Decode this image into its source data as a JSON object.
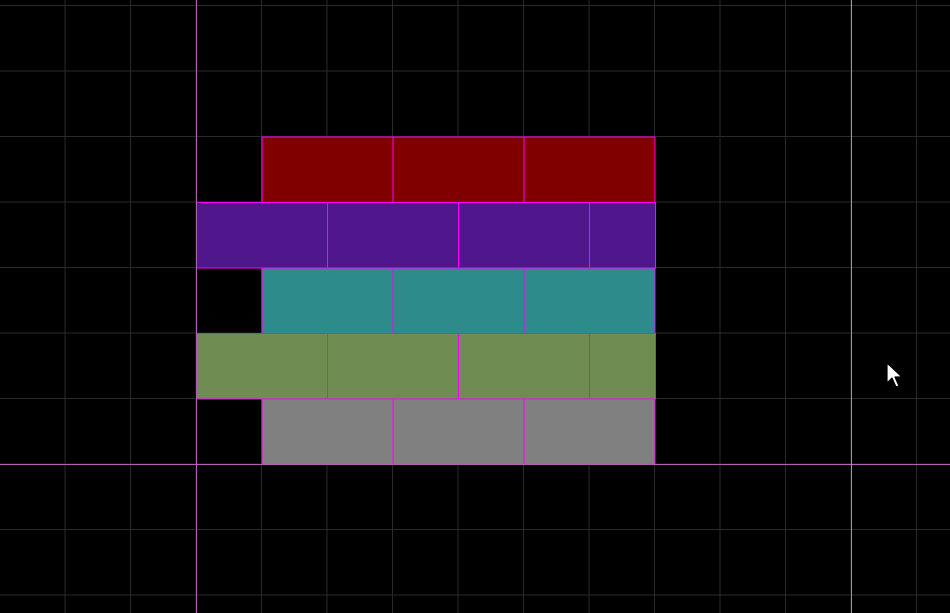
{
  "scene": {
    "background_color": "#000000",
    "grid_line_color": "#2a2a2a",
    "axis_line_color": "#b060b0",
    "guide_line_color": "#cfcfcf",
    "brick_border_color": "#ff00ff"
  },
  "brick_rows": [
    {
      "name": "row-red",
      "color": "#800000",
      "offset": "half",
      "brick_count": 3
    },
    {
      "name": "row-purple",
      "color": "#50168c",
      "offset": "full",
      "brick_count": 3.5
    },
    {
      "name": "row-teal",
      "color": "#2e8b8b",
      "offset": "half",
      "brick_count": 3
    },
    {
      "name": "row-green",
      "color": "#6f8c52",
      "offset": "full",
      "brick_count": 3.5
    },
    {
      "name": "row-gray",
      "color": "#808080",
      "offset": "half",
      "brick_count": 3
    }
  ],
  "cursor": {
    "icon": "mouse-pointer-icon",
    "fill": "#ffffff",
    "stroke": "#000000"
  }
}
